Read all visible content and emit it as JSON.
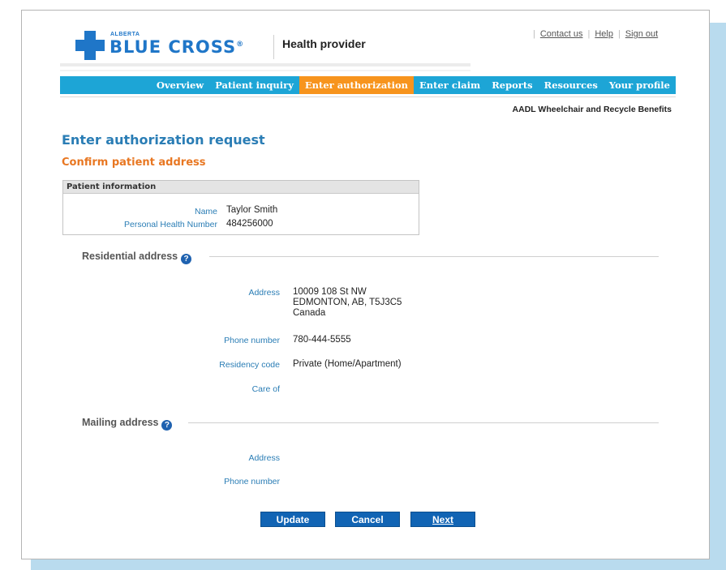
{
  "brand": {
    "logo_small": "ALBERTA",
    "logo_main": "BLUE CROSS",
    "logo_reg": "®",
    "product": "Health provider"
  },
  "toplinks": {
    "contact": "Contact us",
    "help": "Help",
    "signout": "Sign out"
  },
  "nav": {
    "items": [
      {
        "label": "Overview"
      },
      {
        "label": "Patient inquiry"
      },
      {
        "label": "Enter authorization",
        "active": true
      },
      {
        "label": "Enter claim"
      },
      {
        "label": "Reports"
      },
      {
        "label": "Resources"
      },
      {
        "label": "Your profile"
      }
    ]
  },
  "program": "AADL Wheelchair and Recycle Benefits",
  "page": {
    "title": "Enter authorization request",
    "subtitle": "Confirm patient address"
  },
  "patient": {
    "header": "Patient information",
    "name_label": "Name",
    "name_value": "Taylor Smith",
    "phn_label": "Personal Health Number",
    "phn_value": "484256000"
  },
  "residential": {
    "title": "Residential address",
    "address_label": "Address",
    "address_line1": "10009 108 St NW",
    "address_line2": "EDMONTON, AB, T5J3C5",
    "address_line3": "Canada",
    "phone_label": "Phone number",
    "phone_value": "780-444-5555",
    "residency_label": "Residency code",
    "residency_value": "Private (Home/Apartment)",
    "careof_label": "Care of"
  },
  "mailing": {
    "title": "Mailing address",
    "address_label": "Address",
    "phone_label": "Phone number"
  },
  "buttons": {
    "update": "Update",
    "cancel": "Cancel",
    "next": "Next"
  },
  "colors": {
    "nav": "#1da5d6",
    "nav_active": "#f7941d",
    "title": "#2a7db5",
    "subtitle": "#e87722",
    "button": "#1164b4"
  }
}
